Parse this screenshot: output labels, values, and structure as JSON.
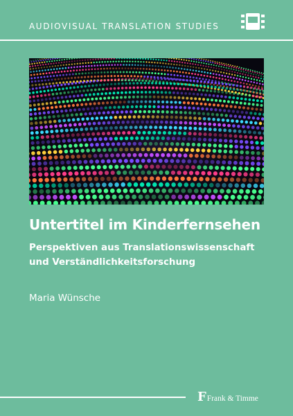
{
  "series": {
    "name": "AUDIOVISUAL TRANSLATION STUDIES",
    "icon": "film-strip-icon"
  },
  "book": {
    "title": "Untertitel im Kinderfernsehen",
    "subtitle_line1": "Perspektiven aus Translationswissenschaft",
    "subtitle_line2": "und Verständlichkeitsforschung",
    "author": "Maria Wünsche"
  },
  "publisher": {
    "mark": "F",
    "name": "Frank & Timme"
  },
  "colors": {
    "background": "#6dbc9d",
    "text": "#ffffff",
    "image_background": "#07070f"
  }
}
